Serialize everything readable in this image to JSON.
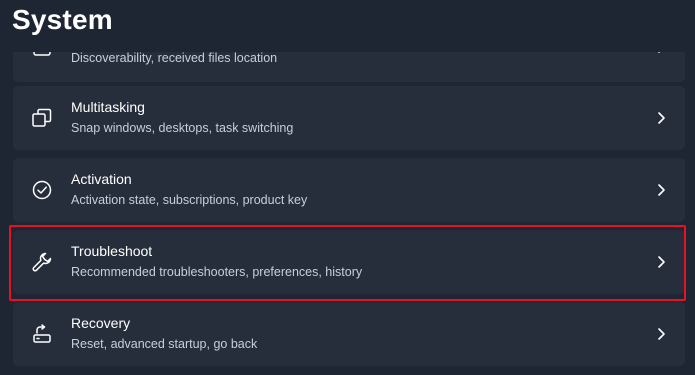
{
  "page": {
    "title": "System"
  },
  "items": [
    {
      "title": "",
      "description": "Discoverability, received files location",
      "icon": "nearby-sharing-icon"
    },
    {
      "title": "Multitasking",
      "description": "Snap windows, desktops, task switching",
      "icon": "multitasking-icon"
    },
    {
      "title": "Activation",
      "description": "Activation state, subscriptions, product key",
      "icon": "activation-check-icon"
    },
    {
      "title": "Troubleshoot",
      "description": "Recommended troubleshooters, preferences, history",
      "icon": "wrench-icon"
    },
    {
      "title": "Recovery",
      "description": "Reset, advanced startup, go back",
      "icon": "recovery-icon"
    }
  ],
  "highlight": {
    "target": "Troubleshoot",
    "color": "#e81123"
  },
  "colors": {
    "background": "#1e2533",
    "card": "#272e3b",
    "text": "#ffffff",
    "subtext": "#c9ced8"
  }
}
